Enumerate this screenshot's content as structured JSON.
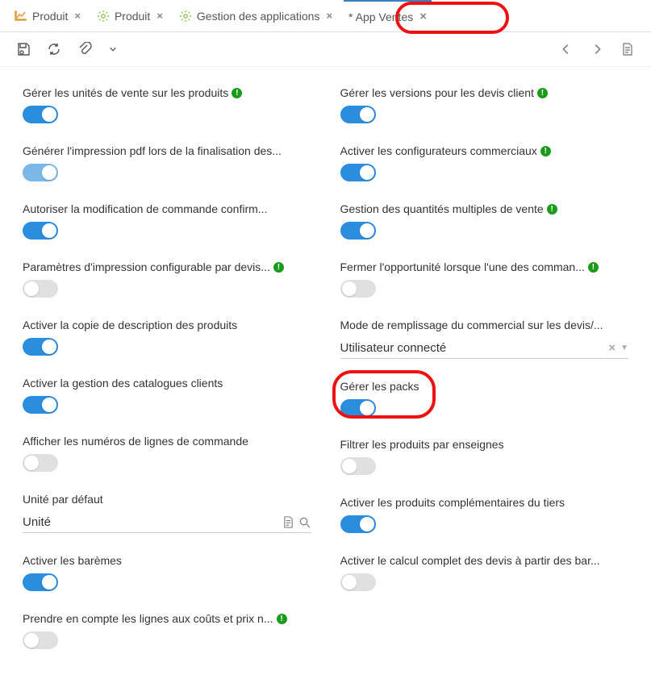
{
  "tabs": [
    {
      "label": "Produit"
    },
    {
      "label": "Produit"
    },
    {
      "label": "Gestion des applications"
    },
    {
      "label": "* App Ventes"
    }
  ],
  "left": {
    "f0": {
      "label": "Gérer les unités de vente sur les produits"
    },
    "f1": {
      "label": "Générer l'impression pdf lors de la finalisation des..."
    },
    "f2": {
      "label": "Autoriser la modification de commande confirm..."
    },
    "f3": {
      "label": "Paramètres d'impression configurable par devis..."
    },
    "f4": {
      "label": "Activer la copie de description des produits"
    },
    "f5": {
      "label": "Activer la gestion des catalogues clients"
    },
    "f6": {
      "label": "Afficher les numéros de lignes de commande"
    },
    "f7": {
      "label": "Unité par défaut",
      "value": "Unité"
    },
    "f8": {
      "label": "Activer les barèmes"
    },
    "f9": {
      "label": "Prendre en compte les lignes aux coûts et prix n..."
    }
  },
  "right": {
    "f0": {
      "label": "Gérer les versions pour les devis client"
    },
    "f1": {
      "label": "Activer les configurateurs commerciaux"
    },
    "f2": {
      "label": "Gestion des quantités multiples de vente"
    },
    "f3": {
      "label": "Fermer l'opportunité lorsque l'une des comman..."
    },
    "f4": {
      "label": "Mode de remplissage du commercial sur les devis/...",
      "value": "Utilisateur connecté"
    },
    "f5": {
      "label": "Gérer les packs"
    },
    "f6": {
      "label": "Filtrer les produits par enseignes"
    },
    "f7": {
      "label": "Activer les produits complémentaires du tiers"
    },
    "f8": {
      "label": "Activer le calcul complet des devis à partir des bar..."
    }
  }
}
